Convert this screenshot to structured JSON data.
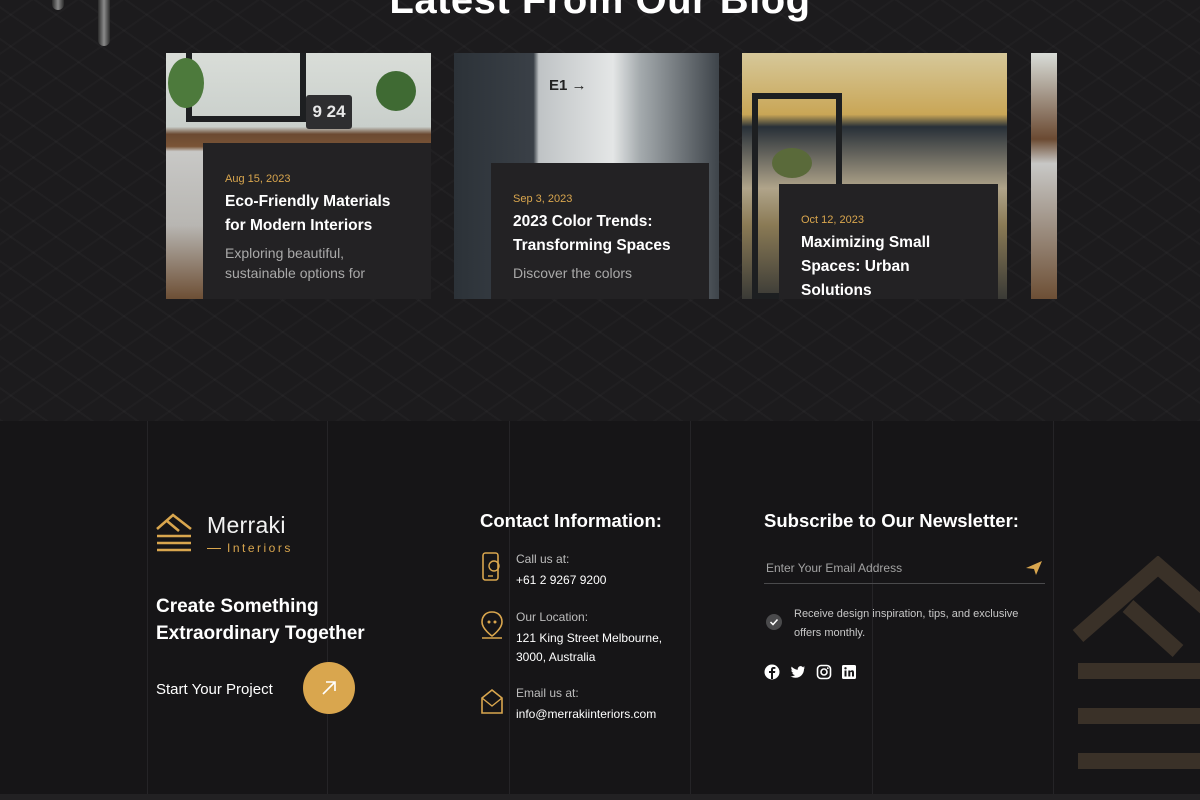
{
  "blog": {
    "heading": "Latest From Our Blog",
    "posts": [
      {
        "date": "Aug 15, 2023",
        "title": "Eco-Friendly Materials for Modern Interiors",
        "excerpt": "Exploring beautiful, sustainable options for",
        "clock": "9 24"
      },
      {
        "date": "Sep 3, 2023",
        "title": "2023 Color Trends: Transforming Spaces",
        "excerpt": "Discover the colors",
        "sign": "E1 →"
      },
      {
        "date": "Oct 12, 2023",
        "title": "Maximizing Small Spaces: Urban Solutions",
        "excerpt": ""
      }
    ]
  },
  "footer": {
    "brand": {
      "name": "Merraki",
      "sub": "Interiors"
    },
    "tagline_line1": "Create Something",
    "tagline_line2": "Extraordinary Together",
    "cta_label": "Start Your Project",
    "contact": {
      "heading": "Contact Information:",
      "call_label": "Call us at:",
      "call_value": "+61 2 9267 9200",
      "location_label": "Our Location:",
      "location_line1": "121 King Street Melbourne,",
      "location_line2": "3000, Australia",
      "email_label": "Email us at:",
      "email_value": "info@merrakiinteriors.com"
    },
    "newsletter": {
      "heading": "Subscribe to Our Newsletter:",
      "placeholder": "Enter Your Email Address",
      "consent": "Receive design inspiration, tips, and exclusive offers monthly."
    },
    "social": [
      "facebook-icon",
      "twitter-icon",
      "instagram-icon",
      "linkedin-icon"
    ]
  },
  "colors": {
    "accent": "#d9a64e",
    "background": "#161517",
    "panel": "#232224"
  }
}
